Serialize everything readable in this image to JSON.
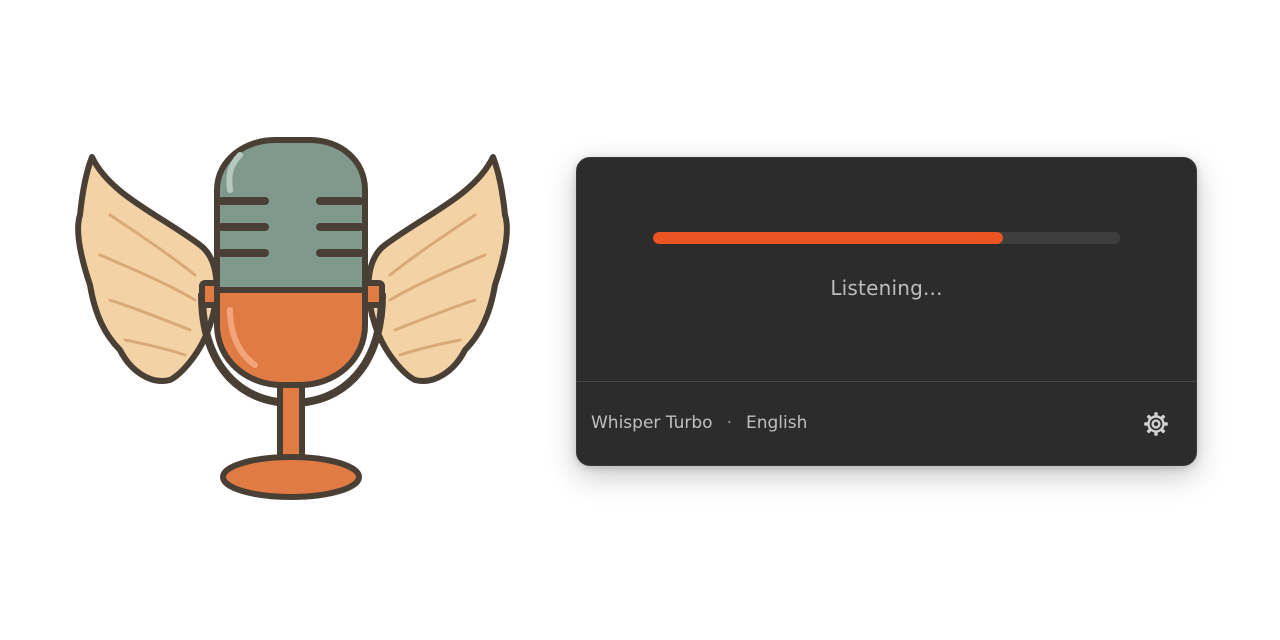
{
  "logo": {
    "icon": "winged-microphone-icon",
    "colors": {
      "outline": "#4a3f35",
      "mic_top": "#7f9a8c",
      "mic_bottom": "#e07b44",
      "wings": "#f3d3a6",
      "stand": "#e07b44"
    }
  },
  "panel": {
    "progress": {
      "value": 0.75,
      "track_color": "#3e3e3e",
      "fill_color": "#e95420"
    },
    "status_text": "Listening...",
    "footer": {
      "model": "Whisper Turbo",
      "separator": "·",
      "language": "English",
      "settings_icon": "gear-icon"
    }
  }
}
